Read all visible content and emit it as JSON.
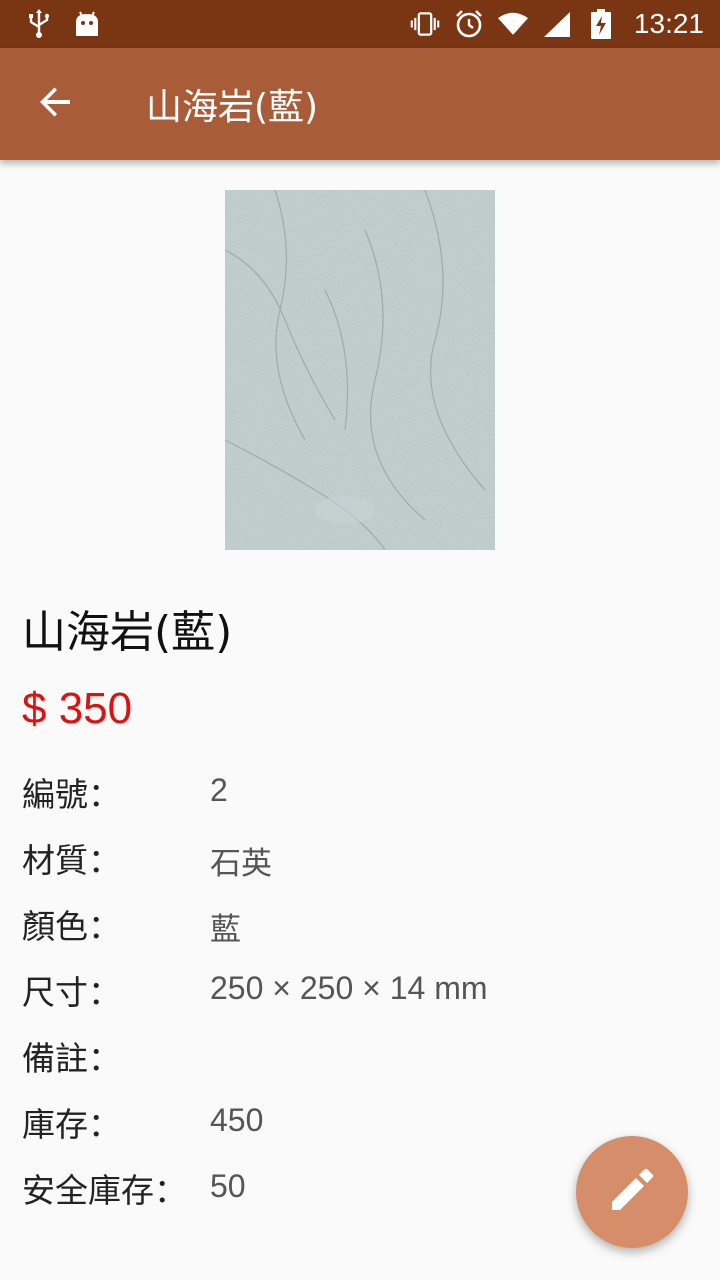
{
  "status_bar": {
    "time": "13:21",
    "icons_left": [
      "usb-icon",
      "android-debug-icon"
    ],
    "icons_right": [
      "vibrate-icon",
      "alarm-icon",
      "wifi-icon",
      "signal-icon",
      "battery-charging-icon"
    ]
  },
  "app_bar": {
    "title": "山海岩(藍)",
    "back_icon": "arrow-back-icon",
    "color": "#a85c38"
  },
  "product": {
    "image_description_icon": "stone-tile-image",
    "name": "山海岩(藍)",
    "price": "$ 350",
    "price_color": "#e01010"
  },
  "details": [
    {
      "label": "編號：",
      "value": "2"
    },
    {
      "label": "材質：",
      "value": "石英"
    },
    {
      "label": "顏色：",
      "value": "藍"
    },
    {
      "label": "尺寸：",
      "value": "250 × 250 ×  14 mm"
    },
    {
      "label": "備註：",
      "value": ""
    },
    {
      "label": "庫存：",
      "value": "450"
    },
    {
      "label": "安全庫存：",
      "value": "50"
    }
  ],
  "fab": {
    "icon": "edit-pencil-icon",
    "color": "#d58d6a"
  }
}
